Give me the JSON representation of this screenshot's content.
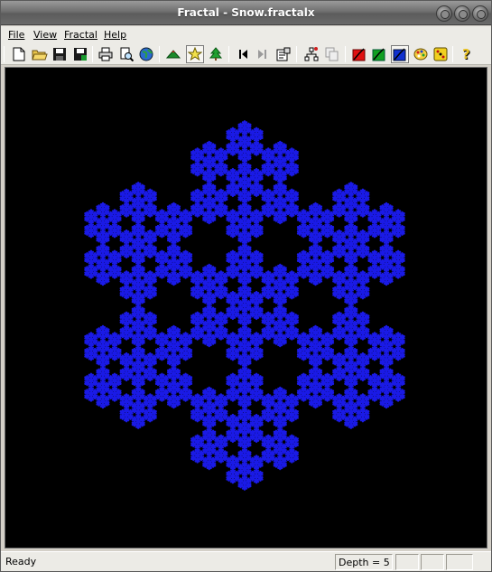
{
  "window": {
    "title": "Fractal - Snow.fractalx"
  },
  "menu": {
    "file": "File",
    "view": "View",
    "fractal": "Fractal",
    "help": "Help"
  },
  "toolbar": {
    "items": [
      "new-file-icon",
      "open-folder-icon",
      "save-icon",
      "save-all-icon",
      "print-icon",
      "print-preview-icon",
      "globe-icon",
      "mountain-icon",
      "star-icon",
      "tree-icon",
      "step-back-icon",
      "step-forward-icon",
      "properties-icon",
      "hierarchy-icon",
      "copy-icon",
      "red-flag-icon",
      "green-flag-icon",
      "blue-flag-icon",
      "palette-icon",
      "dice-icon",
      "help-icon"
    ]
  },
  "fractal": {
    "name": "Snow",
    "depth": 5,
    "color": "#1a1ae6",
    "background": "#000000"
  },
  "status": {
    "ready": "Ready",
    "depth_label": "Depth = 5"
  },
  "colors": {
    "accent_red": "#e01010",
    "accent_green": "#10a020",
    "accent_blue": "#1030d0"
  }
}
